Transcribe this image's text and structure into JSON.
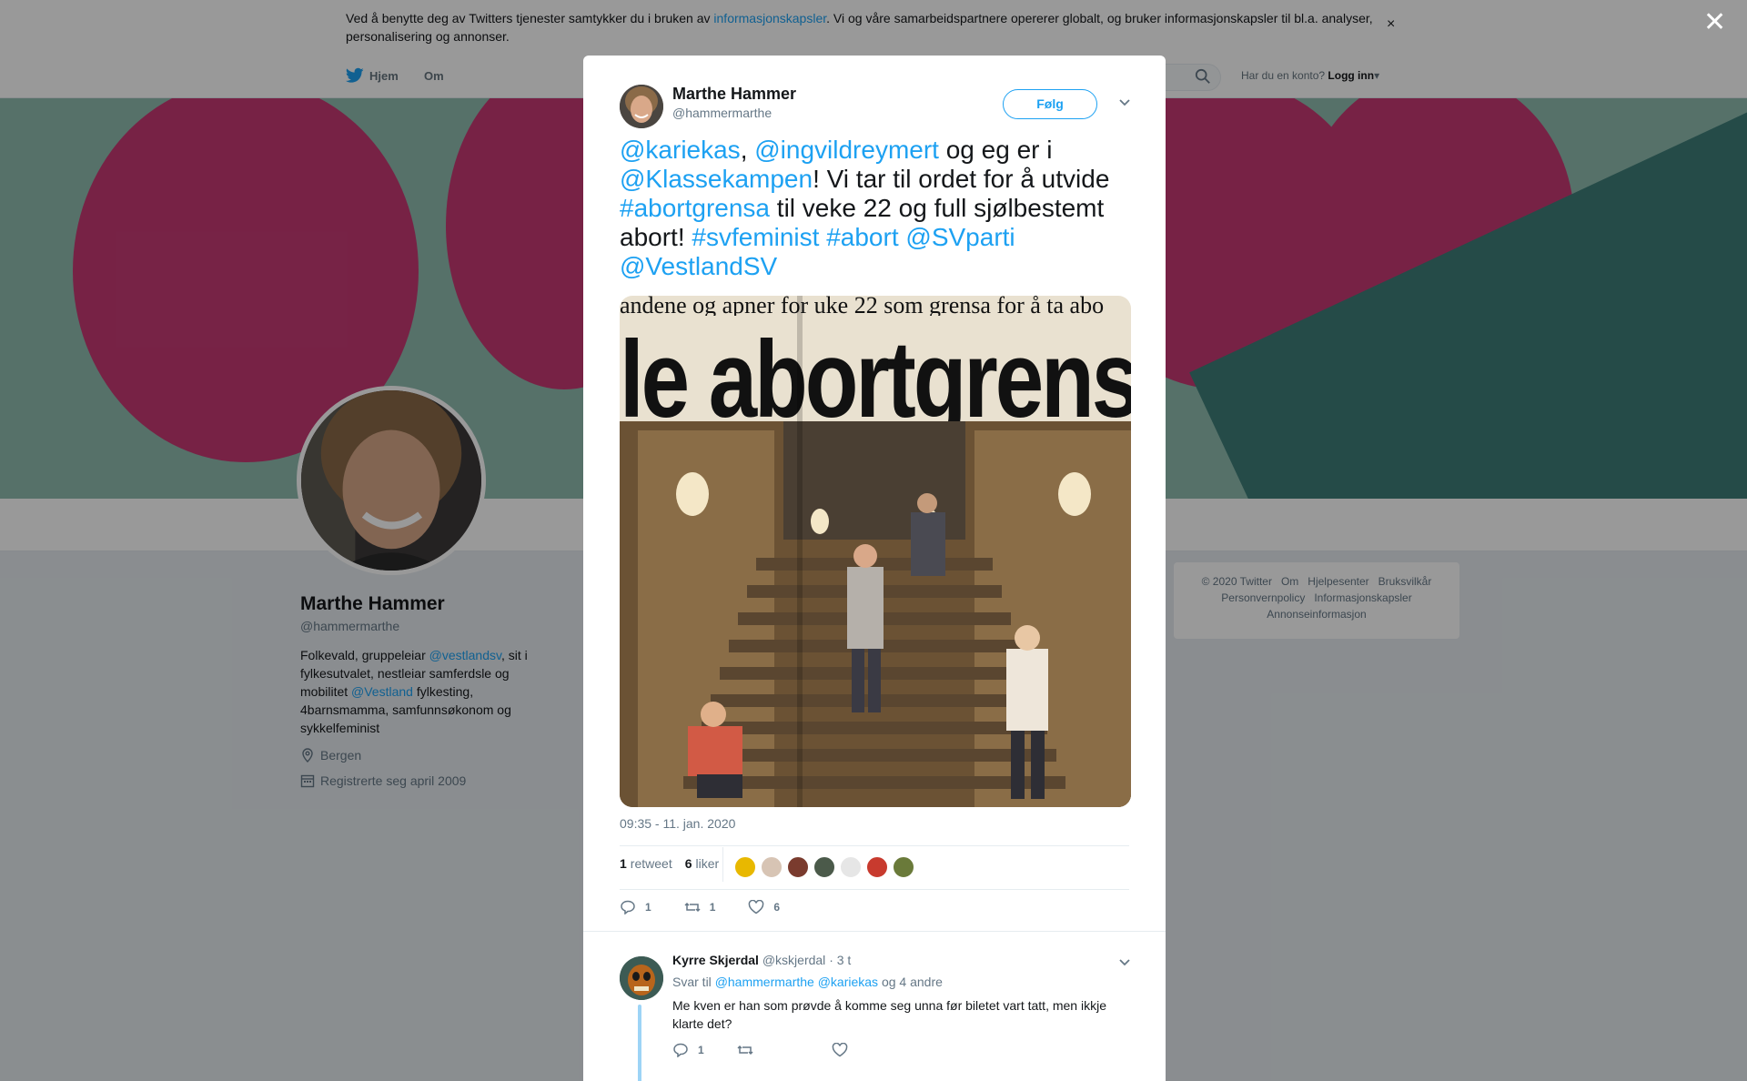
{
  "cookie": {
    "text_before": "Ved å benytte deg av Twitters tjenester samtykker du i bruken av ",
    "link": "informasjonskapsler",
    "text_after": ". Vi og våre samarbeidspartnere opererer globalt, og bruker informasjonskapsler til bl.a. analyser, personalisering og annonser.",
    "close": "×"
  },
  "nav": {
    "home": "Hjem",
    "about": "Om",
    "account_prompt": "Har du en konto?",
    "login": "Logg inn"
  },
  "profile": {
    "name": "Marthe Hammer",
    "handle": "@hammermarthe",
    "bio_1": "Folkevald, gruppeleiar ",
    "bio_link_1": "@vestlandsv",
    "bio_2": ", sit i fylkesutvalet, nestleiar samferdsle og mobilitet ",
    "bio_link_2": "@Vestland",
    "bio_3": " fylkesting, 4barnsmamma, samfunnsøkonom og sykkelfeminist",
    "location": "Bergen",
    "joined": "Registrerte seg april 2009"
  },
  "footer": {
    "items": [
      "© 2020 Twitter",
      "Om",
      "Hjelpesenter",
      "Bruksvilkår",
      "Personvernpolicy",
      "Informasjonskapsler",
      "Annonseinformasjon"
    ]
  },
  "overlay": {
    "close": "✕"
  },
  "tweet": {
    "author_name": "Marthe Hammer",
    "author_handle": "@hammermarthe",
    "follow": "Følg",
    "t1": "@kariekas",
    "t2": ", ",
    "t3": "@ingvildreymert",
    "t4": " og eg er i ",
    "t5": "@Klassekampen",
    "t6": "!  Vi tar til ordet for å utvide ",
    "t7": "#abortgrensa",
    "t8": " til veke 22 og full sjølbestemt abort! ",
    "t9": "#svfeminist",
    "t10": " ",
    "t11": "#abort",
    "t12": " ",
    "t13": "@SVparti",
    "t14": " ",
    "t15": "@VestlandSV",
    "photo_topline": "andene og apner for uke 22 som grensa for å ta abo",
    "photo_headline": "le abortgrensa",
    "time": "09:35 - 11. jan. 2020",
    "retweets_count": "1",
    "retweets_label": "retweet",
    "likes_count": "6",
    "likes_label": "liker",
    "reply_count": "1",
    "retweet_count": "1",
    "like_count": "6"
  },
  "reply": {
    "name": "Kyrre Skjerdal",
    "handle": "@kskjerdal",
    "time": "· 3 t",
    "reply_prefix": "Svar til ",
    "reply_link": "@hammermarthe @kariekas",
    "reply_suffix": " og 4 andre",
    "text": "Me kven er han som prøvde å komme seg unna før biletet vart tatt, men ikkje klarte det?",
    "reply_count": "1"
  },
  "colors": {
    "accent": "#1da1f2",
    "banner_teal": "#8fbcb0",
    "banner_pink": "#c73a74",
    "text_secondary": "#657786"
  }
}
